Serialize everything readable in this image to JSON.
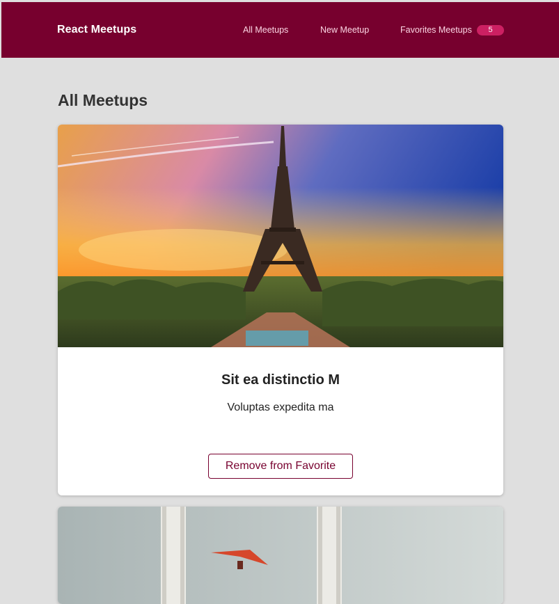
{
  "header": {
    "logo": "React Meetups",
    "nav": {
      "all": "All Meetups",
      "new": "New Meetup",
      "favorites": "Favorites Meetups",
      "favorites_count": "5"
    }
  },
  "page": {
    "title": "All Meetups"
  },
  "meetups": [
    {
      "title": "Sit ea distinctio M",
      "description": "Voluptas expedita ma",
      "button_label": "Remove from Favorite"
    }
  ],
  "colors": {
    "header_bg": "#77002e",
    "badge_bg": "#cc2062",
    "page_bg": "#dfdfdf",
    "accent": "#77002e"
  }
}
